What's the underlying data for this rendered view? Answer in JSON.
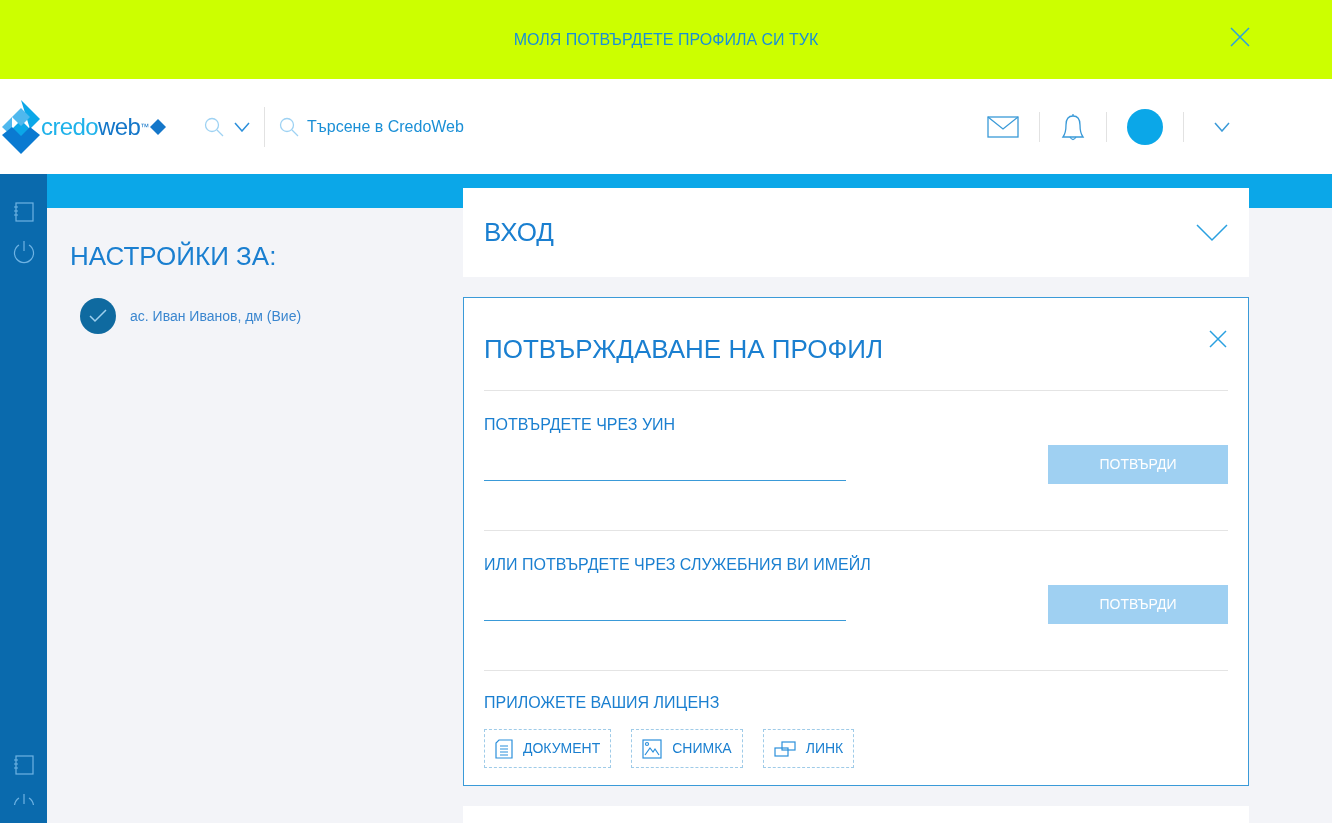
{
  "banner": {
    "text": "МОЛЯ ПОТВЪРДЕТЕ ПРОФИЛА СИ ТУК"
  },
  "header": {
    "logo": {
      "light": "credo",
      "dark": "web",
      "mark": "™"
    },
    "search": {
      "placeholder": "Търсене в CredoWeb"
    }
  },
  "settings": {
    "title": "НАСТРОЙКИ ЗА:",
    "profiles": [
      {
        "name": "ас. Иван Иванов, дм (Вие)",
        "selected": true
      }
    ]
  },
  "login_card": {
    "title": "ВХОД",
    "expanded": false
  },
  "verify_card": {
    "title": "ПОТВЪРЖДАВАНЕ НА ПРОФИЛ",
    "sections": [
      {
        "label": "ПОТВЪРДЕТЕ ЧРЕЗ УИН",
        "button": "ПОТВЪРДИ",
        "disabled": true
      },
      {
        "label": "ИЛИ ПОТВЪРДЕТЕ ЧРЕЗ СЛУЖЕБНИЯ ВИ ИМЕЙЛ",
        "button": "ПОТВЪРДИ",
        "disabled": true
      }
    ],
    "license": {
      "label": "ПРИЛОЖЕТЕ ВАШИЯ ЛИЦЕНЗ",
      "options": [
        {
          "kind": "document",
          "label": "ДОКУМЕНТ"
        },
        {
          "kind": "photo",
          "label": "СНИМКА"
        },
        {
          "kind": "link",
          "label": "ЛИНК"
        }
      ]
    }
  }
}
